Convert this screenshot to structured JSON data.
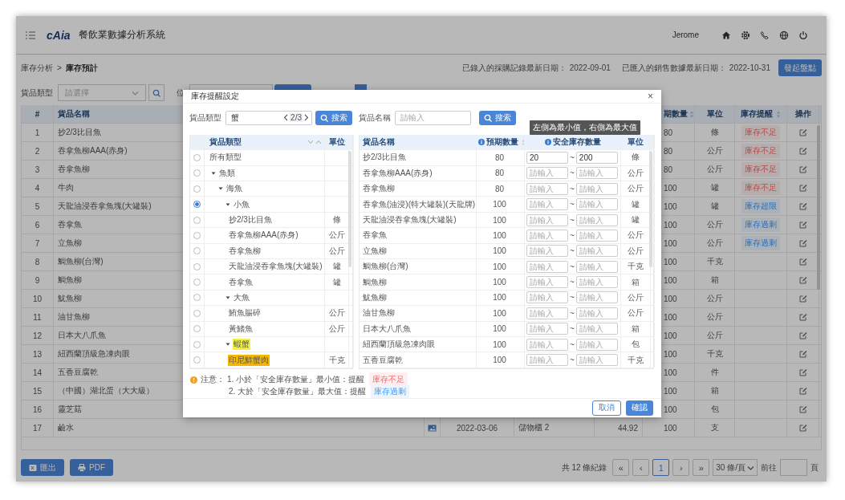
{
  "header": {
    "logo": "cAia",
    "title": "餐飲業數據分析系統",
    "user": "Jerome"
  },
  "breadcrumb": {
    "items": [
      "庫存分析",
      "庫存預計"
    ],
    "separator": ">"
  },
  "dates": [
    {
      "label": "已錄入的採購記錄最新日期：",
      "value": "2022-09-01"
    },
    {
      "label": "已匯入的銷售數據最新日期：",
      "value": "2022-10-31"
    }
  ],
  "stocktake_button": "發起盤點",
  "filters": {
    "category_label": "貨品類型",
    "category_placeholder": "請選擇",
    "location_label": "位"
  },
  "table": {
    "columns": {
      "index": "#",
      "name": "貨品名稱",
      "expected": "期數量",
      "unit": "單位",
      "reminder": "庫存提醒",
      "action": "操作"
    },
    "rows": [
      {
        "no": "1",
        "name": "抄2/3比目魚",
        "expected": "80",
        "unit": "條",
        "reminder": {
          "text": "庫存不足",
          "kind": "shortage"
        }
      },
      {
        "no": "2",
        "name": "吞拿魚柳AAA(赤身)",
        "expected": "80",
        "unit": "公斤",
        "reminder": {
          "text": "庫存不足",
          "kind": "shortage"
        }
      },
      {
        "no": "3",
        "name": "吞拿魚柳",
        "expected": "80",
        "unit": "公斤",
        "reminder": {
          "text": "庫存不足",
          "kind": "shortage"
        }
      },
      {
        "no": "4",
        "name": "牛肉",
        "expected": "100",
        "unit": "罐",
        "reminder": {
          "text": "庫存不足",
          "kind": "shortage"
        }
      },
      {
        "no": "5",
        "name": "天龍油浸吞拿魚塊(大罐裝)",
        "expected": "100",
        "unit": "罐",
        "reminder": {
          "text": "庫存超限",
          "kind": "surplus"
        }
      },
      {
        "no": "6",
        "name": "吞拿魚",
        "expected": "100",
        "unit": "公斤",
        "reminder": {
          "text": "庫存過剩",
          "kind": "surplus"
        }
      },
      {
        "no": "7",
        "name": "立魚柳",
        "expected": "100",
        "unit": "公斤",
        "reminder": {
          "text": "庫存過剩",
          "kind": "surplus"
        }
      },
      {
        "no": "8",
        "name": "鯛魚柳(台灣)",
        "expected": "100",
        "unit": "千克"
      },
      {
        "no": "9",
        "name": "鯛魚柳",
        "expected": "100",
        "unit": "箱"
      },
      {
        "no": "10",
        "name": "魷魚柳",
        "expected": "100",
        "unit": "公斤"
      },
      {
        "no": "11",
        "name": "油甘魚柳",
        "expected": "100",
        "unit": "公斤"
      },
      {
        "no": "12",
        "name": "日本大八爪魚",
        "expected": "100",
        "unit": "公斤"
      },
      {
        "no": "13",
        "name": "紐西蘭頂級急凍肉眼",
        "expected": "100",
        "unit": "千克"
      },
      {
        "no": "14",
        "name": "五香豆腐乾",
        "expected": "100",
        "unit": "件"
      },
      {
        "no": "15",
        "name": "（中國）湖北蛋（大大級）",
        "expected": "100",
        "unit": "箱"
      },
      {
        "no": "16",
        "name": "靈芝菇",
        "expected": "100",
        "unit": "包"
      },
      {
        "no": "17",
        "name": "鹼水",
        "photo": true,
        "date": "2022-03-06",
        "location": "儲物櫃 2",
        "amount": "44.92",
        "expected": "100",
        "unit": "支"
      }
    ]
  },
  "export_buttons": [
    {
      "label": "匯出",
      "kind": "sheet"
    },
    {
      "label": "PDF",
      "kind": "print"
    }
  ],
  "pagination": {
    "total": "共 12 條紀錄",
    "first": "«",
    "prev": "‹",
    "pages": [
      {
        "label": "1",
        "selected": true
      }
    ],
    "next": "›",
    "last": "»",
    "page_size": "30 條/頁",
    "goto_label": "前往",
    "goto_suffix": "頁"
  },
  "modal": {
    "title": "庫存提醒設定",
    "close": "×",
    "left": {
      "search_label": "貨品類型",
      "search_value": "蟹",
      "match_position": "2/3",
      "search_button": "搜索",
      "columns": {
        "type": "貨品類型",
        "unit": "單位"
      },
      "tree": [
        {
          "label": "所有類型",
          "selected": false,
          "matched": false,
          "current_match": false
        },
        {
          "label": "魚類",
          "selected": false,
          "matched": false,
          "current_match": false,
          "expanded": true,
          "children": [
            {
              "label": "海魚",
              "selected": false,
              "matched": false,
              "current_match": false,
              "expanded": true,
              "children": [
                {
                  "label": "小魚",
                  "selected": true,
                  "matched": false,
                  "current_match": false,
                  "expanded": true,
                  "children": [
                    {
                      "label": "抄2/3比目魚",
                      "unit": "條",
                      "selected": false,
                      "matched": false,
                      "current_match": false
                    },
                    {
                      "label": "吞拿魚柳AAA(赤身)",
                      "unit": "公斤",
                      "selected": false,
                      "matched": false,
                      "current_match": false
                    },
                    {
                      "label": "吞拿魚柳",
                      "unit": "公斤",
                      "selected": false,
                      "matched": false,
                      "current_match": false
                    },
                    {
                      "label": "天龍油浸吞拿魚塊(大罐裝)",
                      "unit": "罐",
                      "selected": false,
                      "matched": false,
                      "current_match": false
                    },
                    {
                      "label": "吞拿魚",
                      "unit": "罐",
                      "selected": false,
                      "matched": false,
                      "current_match": false
                    }
                  ]
                },
                {
                  "label": "大魚",
                  "selected": false,
                  "matched": false,
                  "current_match": false,
                  "expanded": true,
                  "children": [
                    {
                      "label": "鮪魚腸碎",
                      "unit": "公斤",
                      "selected": false,
                      "matched": false,
                      "current_match": false
                    },
                    {
                      "label": "黃鰭魚",
                      "unit": "公斤",
                      "selected": false,
                      "matched": false,
                      "current_match": false
                    }
                  ]
                },
                {
                  "label": "蝦蟹",
                  "selected": false,
                  "matched": true,
                  "current_match": false,
                  "expanded": true,
                  "children": [
                    {
                      "label": "印尼鮮蟹肉",
                      "unit": "千克",
                      "selected": false,
                      "matched": false,
                      "current_match": true
                    }
                  ]
                }
              ]
            }
          ]
        }
      ]
    },
    "right": {
      "search_label": "貨品名稱",
      "search_placeholder": "請輸入",
      "search_button": "搜索",
      "tooltip": "左側為最小值，右側為最大值",
      "columns": {
        "name": "貨品名稱",
        "expected": "預期數量",
        "safety": "安全庫存數量",
        "unit": "單位"
      },
      "rows": [
        {
          "name": "抄2/3比目魚",
          "expected": "80",
          "min": {
            "value": "20"
          },
          "separator": "~",
          "max": {
            "value": "200"
          },
          "unit": "條"
        },
        {
          "name": "吞拿魚柳AAA(赤身)",
          "expected": "80",
          "min": {
            "placeholder": "請輸入"
          },
          "separator": "~",
          "max": {
            "placeholder": "請輸入"
          },
          "unit": "公斤"
        },
        {
          "name": "吞拿魚柳",
          "expected": "80",
          "min": {
            "placeholder": "請輸入"
          },
          "separator": "~",
          "max": {
            "placeholder": "請輸入"
          },
          "unit": "公斤"
        },
        {
          "name": "吞拿魚(油浸)(特大罐裝)(天龍牌)",
          "expected": "100",
          "min": {
            "placeholder": "請輸入"
          },
          "separator": "~",
          "max": {
            "placeholder": "請輸入"
          },
          "unit": "罐"
        },
        {
          "name": "天龍油浸吞拿魚塊(大罐裝)",
          "expected": "100",
          "min": {
            "placeholder": "請輸入"
          },
          "separator": "~",
          "max": {
            "placeholder": "請輸入"
          },
          "unit": "罐"
        },
        {
          "name": "吞拿魚",
          "expected": "100",
          "min": {
            "placeholder": "請輸入"
          },
          "separator": "~",
          "max": {
            "placeholder": "請輸入"
          },
          "unit": "公斤"
        },
        {
          "name": "立魚柳",
          "expected": "100",
          "min": {
            "placeholder": "請輸入"
          },
          "separator": "~",
          "max": {
            "placeholder": "請輸入"
          },
          "unit": "公斤"
        },
        {
          "name": "鯛魚柳(台灣)",
          "expected": "100",
          "min": {
            "placeholder": "請輸入"
          },
          "separator": "~",
          "max": {
            "placeholder": "請輸入"
          },
          "unit": "千克"
        },
        {
          "name": "鯛魚柳",
          "expected": "100",
          "min": {
            "placeholder": "請輸入"
          },
          "separator": "~",
          "max": {
            "placeholder": "請輸入"
          },
          "unit": "箱"
        },
        {
          "name": "魷魚柳",
          "expected": "100",
          "min": {
            "placeholder": "請輸入"
          },
          "separator": "~",
          "max": {
            "placeholder": "請輸入"
          },
          "unit": "公斤"
        },
        {
          "name": "油甘魚柳",
          "expected": "100",
          "min": {
            "placeholder": "請輸入"
          },
          "separator": "~",
          "max": {
            "placeholder": "請輸入"
          },
          "unit": "公斤"
        },
        {
          "name": "日本大八爪魚",
          "expected": "100",
          "min": {
            "placeholder": "請輸入"
          },
          "separator": "~",
          "max": {
            "placeholder": "請輸入"
          },
          "unit": "箱"
        },
        {
          "name": "紐西蘭頂級急凍肉眼",
          "expected": "100",
          "min": {
            "placeholder": "請輸入"
          },
          "separator": "~",
          "max": {
            "placeholder": "請輸入"
          },
          "unit": "包"
        },
        {
          "name": "五香豆腐乾",
          "expected": "100",
          "min": {
            "placeholder": "請輸入"
          },
          "separator": "~",
          "max": {
            "placeholder": "請輸入"
          },
          "unit": "千克"
        }
      ]
    },
    "notes": {
      "heading": "注意：",
      "items": [
        {
          "text": "1. 小於「安全庫存數量」最小值：提醒",
          "tag": {
            "text": "庫存不足",
            "kind": "shortage"
          }
        },
        {
          "text": "2. 大於「安全庫存數量」最大值：提醒",
          "tag": {
            "text": "庫存過剩",
            "kind": "surplus"
          }
        }
      ]
    },
    "buttons": [
      {
        "label": "取消",
        "kind": "secondary"
      },
      {
        "label": "確認",
        "kind": "primary"
      }
    ]
  }
}
